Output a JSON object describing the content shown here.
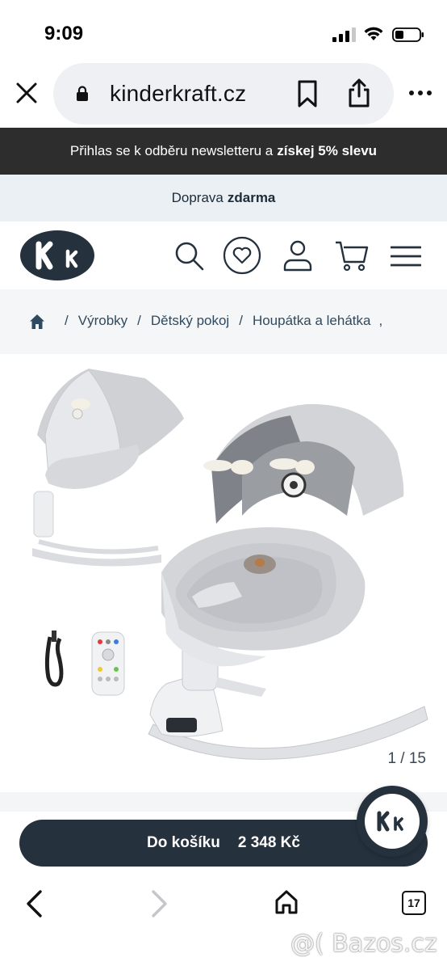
{
  "status_bar": {
    "time": "9:09"
  },
  "browser": {
    "url": "kinderkraft.cz",
    "close_icon": "close-icon",
    "lock_icon": "lock-icon",
    "bookmark_icon": "bookmark-icon",
    "share_icon": "share-icon",
    "more_icon": "more-dots-icon"
  },
  "banners": {
    "newsletter_text": "Přihlas se k odběru newsletteru a",
    "newsletter_bold": "získej 5% slevu",
    "shipping_text": "Doprava",
    "shipping_bold": "zdarma"
  },
  "header": {
    "logo_text": "kk",
    "icons": [
      "search-icon",
      "heart-icon",
      "user-icon",
      "cart-icon",
      "menu-icon"
    ]
  },
  "breadcrumb": {
    "items": [
      "Výrobky",
      "Dětský pokoj",
      "Houpátka a lehátka"
    ],
    "separator": "/",
    "trailing": ","
  },
  "gallery": {
    "counter": "1 / 15"
  },
  "cart": {
    "label": "Do košíku",
    "price": "2 348 Kč"
  },
  "toolbar": {
    "tabs_count": "17"
  },
  "watermark": "@( Bazos.cz",
  "colors": {
    "dark": "#25313d",
    "banner_dark": "#2d2d2d",
    "banner_light": "#eaf0f4",
    "breadcrumb_bg": "#f4f6f8"
  }
}
